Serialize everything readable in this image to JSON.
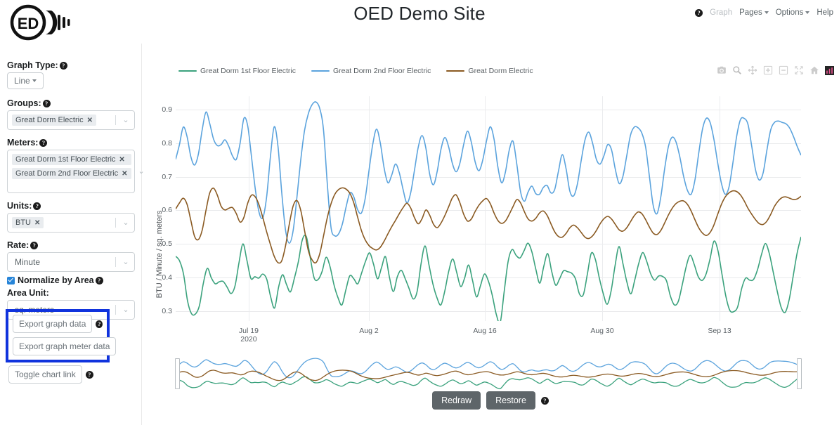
{
  "header": {
    "title": "OED Demo Site",
    "logo_text": "ED",
    "nav": [
      {
        "label": "Graph",
        "state": "disabled",
        "caret": false
      },
      {
        "label": "Pages",
        "state": "active",
        "caret": true
      },
      {
        "label": "Options",
        "state": "active",
        "caret": true
      },
      {
        "label": "Help",
        "state": "active",
        "caret": false
      }
    ],
    "nav_help_icon": "?"
  },
  "sidebar": {
    "graph_type": {
      "label": "Graph Type:",
      "value": "Line",
      "help": "?"
    },
    "groups": {
      "label": "Groups:",
      "help": "?",
      "chips": [
        "Great Dorm Electric"
      ]
    },
    "meters": {
      "label": "Meters:",
      "help": "?",
      "chips": [
        "Great Dorm 1st Floor Electric",
        "Great Dorm 2nd Floor Electric"
      ]
    },
    "units": {
      "label": "Units:",
      "help": "?",
      "chips": [
        "BTU"
      ]
    },
    "rate": {
      "label": "Rate:",
      "help": "?",
      "value": "Minute"
    },
    "normalize": {
      "label": "Normalize by Area",
      "help": "?",
      "checked": true
    },
    "area_unit": {
      "label": "Area Unit:",
      "value": "sq. meters"
    },
    "export_graph_data": {
      "label": "Export graph data",
      "help": "?"
    },
    "export_graph_meter_data": {
      "label": "Export graph meter data"
    },
    "toggle_chart_link": {
      "label": "Toggle chart link",
      "help": "?"
    },
    "highlight_color": "#1033dd"
  },
  "footer": {
    "redraw": "Redraw",
    "restore": "Restore",
    "help": "?"
  },
  "modebar": {
    "icons": [
      "camera-icon",
      "zoom-icon",
      "pan-icon",
      "zoom-in-icon",
      "zoom-out-icon",
      "autoscale-icon",
      "reset-axes-home-icon",
      "plotly-logo-icon"
    ]
  },
  "chart_data": {
    "type": "line",
    "title": "",
    "xlabel": "",
    "ylabel": "BTU / Minute / sq. meters",
    "ylim": [
      0.27,
      0.94
    ],
    "yticks": [
      0.3,
      0.4,
      0.5,
      0.6,
      0.7,
      0.8,
      0.9
    ],
    "ytick_labels": [
      "0.3",
      "0.4",
      "0.5",
      "0.6",
      "0.7",
      "0.8",
      "0.9"
    ],
    "xticks": [
      {
        "label": "Jul 19",
        "sublabel": "2020",
        "pos": 0.1168
      },
      {
        "label": "Aug 2",
        "sublabel": "",
        "pos": 0.309
      },
      {
        "label": "Aug 16",
        "sublabel": "",
        "pos": 0.4944
      },
      {
        "label": "Aug 30",
        "sublabel": "",
        "pos": 0.682
      },
      {
        "label": "Sep 13",
        "sublabel": "",
        "pos": 0.8697
      }
    ],
    "grid": true,
    "legend_position": "top-left",
    "rangeslider": true,
    "series": [
      {
        "name": "Great Dorm 1st Floor Electric",
        "color": "#3ba27d",
        "values": [
          0.463,
          0.449,
          0.409,
          0.33,
          0.292,
          0.291,
          0.316,
          0.383,
          0.427,
          0.399,
          0.381,
          0.387,
          0.388,
          0.371,
          0.352,
          0.375,
          0.444,
          0.5,
          0.451,
          0.397,
          0.402,
          0.398,
          0.41,
          0.395,
          0.342,
          0.309,
          0.371,
          0.408,
          0.379,
          0.357,
          0.398,
          0.447,
          0.512,
          0.522,
          0.459,
          0.398,
          0.394,
          0.418,
          0.46,
          0.432,
          0.378,
          0.34,
          0.318,
          0.363,
          0.405,
          0.396,
          0.381,
          0.414,
          0.449,
          0.473,
          0.439,
          0.396,
          0.429,
          0.462,
          0.401,
          0.358,
          0.402,
          0.421,
          0.396,
          0.366,
          0.336,
          0.358,
          0.441,
          0.494,
          0.437,
          0.38,
          0.34,
          0.318,
          0.36,
          0.419,
          0.455,
          0.415,
          0.373,
          0.398,
          0.437,
          0.391,
          0.342,
          0.375,
          0.41,
          0.389,
          0.346,
          0.29,
          0.266,
          0.358,
          0.448,
          0.483,
          0.466,
          0.458,
          0.479,
          0.502,
          0.476,
          0.424,
          0.383,
          0.433,
          0.471,
          0.418,
          0.377,
          0.396,
          0.42,
          0.417,
          0.413,
          0.396,
          0.351,
          0.349,
          0.409,
          0.472,
          0.455,
          0.4,
          0.353,
          0.32,
          0.359,
          0.434,
          0.492,
          0.441,
          0.386,
          0.351,
          0.393,
          0.442,
          0.474,
          0.448,
          0.411,
          0.392,
          0.404,
          0.403,
          0.39,
          0.344,
          0.318,
          0.329,
          0.379,
          0.433,
          0.466,
          0.439,
          0.403,
          0.391,
          0.41,
          0.455,
          0.508,
          0.48,
          0.411,
          0.344,
          0.302,
          0.298,
          0.313,
          0.367,
          0.398,
          0.392,
          0.394,
          0.423,
          0.468,
          0.501,
          0.47,
          0.414,
          0.358,
          0.31,
          0.296,
          0.334,
          0.403,
          0.472,
          0.521
        ]
      },
      {
        "name": "Great Dorm 2nd Floor Electric",
        "color": "#5ba3dd",
        "values": [
          0.752,
          0.796,
          0.848,
          0.82,
          0.76,
          0.735,
          0.768,
          0.84,
          0.893,
          0.858,
          0.812,
          0.793,
          0.796,
          0.81,
          0.791,
          0.762,
          0.752,
          0.8,
          0.874,
          0.852,
          0.76,
          0.664,
          0.594,
          0.578,
          0.64,
          0.76,
          0.849,
          0.79,
          0.651,
          0.54,
          0.502,
          0.54,
          0.64,
          0.75,
          0.838,
          0.888,
          0.915,
          0.923,
          0.904,
          0.84,
          0.68,
          0.548,
          0.524,
          0.53,
          0.56,
          0.612,
          0.652,
          0.64,
          0.602,
          0.592,
          0.635,
          0.718,
          0.797,
          0.842,
          0.8,
          0.726,
          0.682,
          0.705,
          0.738,
          0.712,
          0.662,
          0.622,
          0.652,
          0.719,
          0.788,
          0.823,
          0.786,
          0.709,
          0.676,
          0.716,
          0.782,
          0.817,
          0.79,
          0.74,
          0.715,
          0.741,
          0.797,
          0.836,
          0.803,
          0.745,
          0.718,
          0.749,
          0.806,
          0.849,
          0.812,
          0.73,
          0.682,
          0.714,
          0.779,
          0.806,
          0.738,
          0.655,
          0.627,
          0.655,
          0.672,
          0.65,
          0.648,
          0.668,
          0.674,
          0.652,
          0.662,
          0.717,
          0.766,
          0.724,
          0.657,
          0.643,
          0.679,
          0.749,
          0.81,
          0.833,
          0.8,
          0.752,
          0.738,
          0.763,
          0.796,
          0.78,
          0.722,
          0.68,
          0.701,
          0.762,
          0.824,
          0.848,
          0.846,
          0.83,
          0.788,
          0.7,
          0.614,
          0.59,
          0.64,
          0.723,
          0.79,
          0.818,
          0.804,
          0.76,
          0.702,
          0.66,
          0.648,
          0.69,
          0.77,
          0.842,
          0.874,
          0.862,
          0.812,
          0.742,
          0.68,
          0.648,
          0.67,
          0.74,
          0.82,
          0.87,
          0.874,
          0.856,
          0.79,
          0.72,
          0.69,
          0.712,
          0.78,
          0.84,
          0.862,
          0.866,
          0.862,
          0.858,
          0.845,
          0.82,
          0.79,
          0.764
        ]
      },
      {
        "name": "Great Dorm Electric",
        "color": "#8a5a22",
        "values": [
          0.604,
          0.622,
          0.636,
          0.618,
          0.57,
          0.522,
          0.513,
          0.541,
          0.6,
          0.652,
          0.666,
          0.645,
          0.612,
          0.601,
          0.606,
          0.608,
          0.59,
          0.565,
          0.579,
          0.621,
          0.645,
          0.64,
          0.616,
          0.578,
          0.536,
          0.498,
          0.463,
          0.444,
          0.45,
          0.495,
          0.56,
          0.613,
          0.629,
          0.6,
          0.54,
          0.48,
          0.452,
          0.444,
          0.47,
          0.523,
          0.578,
          0.62,
          0.648,
          0.662,
          0.667,
          0.663,
          0.65,
          0.622,
          0.58,
          0.54,
          0.512,
          0.495,
          0.486,
          0.482,
          0.49,
          0.508,
          0.53,
          0.551,
          0.57,
          0.59,
          0.608,
          0.621,
          0.607,
          0.578,
          0.56,
          0.575,
          0.601,
          0.586,
          0.559,
          0.548,
          0.562,
          0.584,
          0.61,
          0.637,
          0.646,
          0.622,
          0.588,
          0.568,
          0.574,
          0.596,
          0.615,
          0.628,
          0.635,
          0.62,
          0.592,
          0.57,
          0.561,
          0.568,
          0.588,
          0.611,
          0.632,
          0.622,
          0.596,
          0.574,
          0.568,
          0.576,
          0.592,
          0.598,
          0.585,
          0.56,
          0.536,
          0.522,
          0.52,
          0.531,
          0.548,
          0.556,
          0.548,
          0.534,
          0.52,
          0.516,
          0.524,
          0.54,
          0.56,
          0.575,
          0.582,
          0.574,
          0.558,
          0.542,
          0.538,
          0.548,
          0.566,
          0.584,
          0.595,
          0.59,
          0.572,
          0.55,
          0.532,
          0.528,
          0.54,
          0.562,
          0.586,
          0.606,
          0.62,
          0.627,
          0.628,
          0.618,
          0.598,
          0.572,
          0.548,
          0.532,
          0.525,
          0.534,
          0.556,
          0.588,
          0.618,
          0.64,
          0.652,
          0.658,
          0.656,
          0.646,
          0.628,
          0.606,
          0.588,
          0.572,
          0.56,
          0.558,
          0.568,
          0.588,
          0.612,
          0.628,
          0.638,
          0.64,
          0.636,
          0.632,
          0.634,
          0.642
        ]
      }
    ]
  }
}
